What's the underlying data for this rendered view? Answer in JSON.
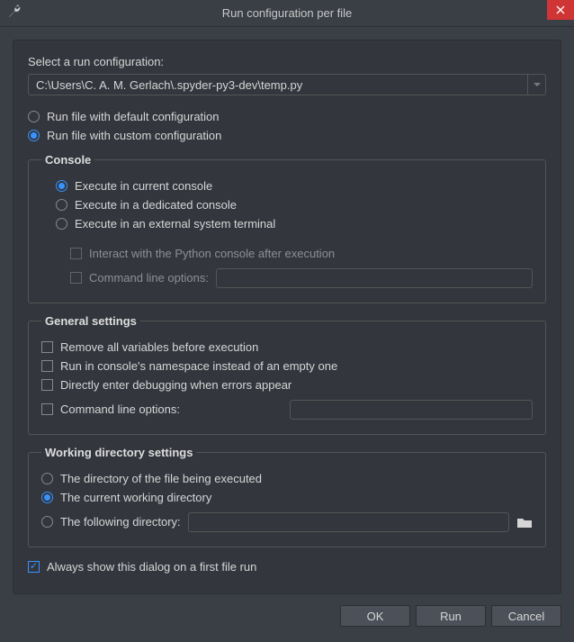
{
  "window": {
    "title": "Run configuration per file"
  },
  "prompt": "Select a run configuration:",
  "combo_value": "C:\\Users\\C. A. M. Gerlach\\.spyder-py3-dev\\temp.py",
  "radios": {
    "default_cfg": "Run file with default configuration",
    "custom_cfg": "Run file with custom configuration"
  },
  "console": {
    "legend": "Console",
    "exec_current": "Execute in current console",
    "exec_dedicated": "Execute in a dedicated console",
    "exec_external": "Execute in an external system terminal",
    "interact_after": "Interact with the Python console after execution",
    "cmd_opts": "Command line options:"
  },
  "general": {
    "legend": "General settings",
    "remove_vars": "Remove all variables before execution",
    "run_namespace": "Run in console's namespace instead of an empty one",
    "debug_on_error": "Directly enter debugging when errors appear",
    "cmd_opts": "Command line options:"
  },
  "workdir": {
    "legend": "Working directory settings",
    "dir_of_file": "The directory of the file being executed",
    "cwd": "The current working directory",
    "following": "The following directory:"
  },
  "always_show": "Always show this dialog on a first file run",
  "buttons": {
    "ok": "OK",
    "run": "Run",
    "cancel": "Cancel"
  }
}
